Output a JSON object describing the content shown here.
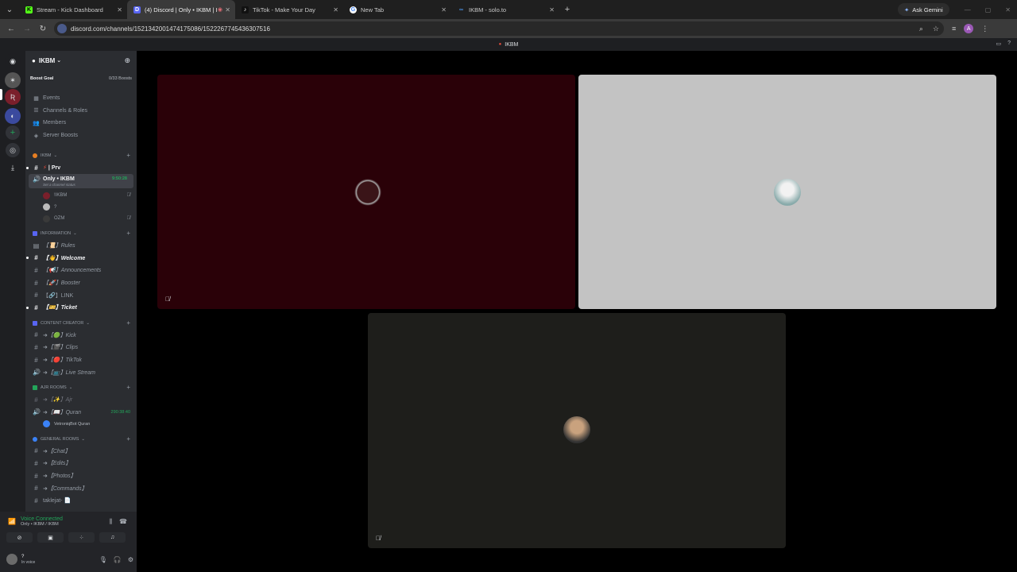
{
  "browser": {
    "tabs": [
      {
        "title": "Stream - Kick Dashboard",
        "favicon": "K",
        "color": "#53fc18",
        "active": false
      },
      {
        "title": "(4) Discord | Only • IKBM | I",
        "favicon": "D",
        "color": "#5865f2",
        "active": true
      },
      {
        "title": "TikTok - Make Your Day",
        "favicon": "♪",
        "color": "#000000",
        "active": false
      },
      {
        "title": "New Tab",
        "favicon": "G",
        "color": "#4285f4",
        "active": false
      },
      {
        "title": "IKBM - solo.to",
        "favicon": "∞",
        "color": "#4a90e2",
        "active": false
      }
    ],
    "gemini_label": "Ask Gemini",
    "url": "discord.com/channels/1521342001474175086/1522267745436307516",
    "profile_initial": "A"
  },
  "discord": {
    "window_title": "IKBM",
    "server_name": "IKBM",
    "boost_goal": {
      "label": "Boost Goal",
      "progress": "0/33 Boosts"
    },
    "menu": [
      {
        "label": "Events",
        "icon": "calendar-icon",
        "glyph": "▦"
      },
      {
        "label": "Channels & Roles",
        "icon": "channels-icon",
        "glyph": "☰"
      },
      {
        "label": "Members",
        "icon": "members-icon",
        "glyph": "👥"
      },
      {
        "label": "Server Boosts",
        "icon": "boost-icon",
        "glyph": "◈"
      }
    ],
    "cat_ikbm": "IKBM",
    "prv_channel": "| Prv",
    "voice_active": {
      "name": "Only • IKBM",
      "status": "Set a channel status",
      "timer": "9:50:28"
    },
    "voice_users": [
      {
        "name": "!IKBM",
        "color": "#7a1f2b",
        "muted": true
      },
      {
        "name": "?",
        "color": "#bbbbbb",
        "muted": false
      },
      {
        "name": "OZM",
        "color": "#3a3a3a",
        "muted": true
      }
    ],
    "cat_information": "INFORMATION",
    "info_channels": [
      {
        "label": "【📜】Rules",
        "icon": "rules-icon",
        "bold": false,
        "unread": false
      },
      {
        "label": "【👋】Welcome",
        "icon": "hash-icon",
        "bold": true,
        "unread": true
      },
      {
        "label": "【📢】Announcements",
        "icon": "hash-icon",
        "bold": false,
        "unread": false
      },
      {
        "label": "【🚀】Booster",
        "icon": "hash-icon",
        "bold": false,
        "unread": false
      },
      {
        "label": "【🔗】LINK",
        "icon": "hash-icon",
        "bold": false,
        "unread": false
      },
      {
        "label": "【🎫】Ticket",
        "icon": "hash-icon",
        "bold": true,
        "unread": true
      }
    ],
    "cat_content": "CONTENT CREATOR",
    "content_channels": [
      {
        "label": "➜【🟢】Kick",
        "icon": "hash-icon"
      },
      {
        "label": "➜【🎬】Clips",
        "icon": "hash-icon"
      },
      {
        "label": "➜【🔴】TikTok",
        "icon": "hash-icon"
      },
      {
        "label": "➜【📺】Live Stream",
        "icon": "speaker-icon"
      }
    ],
    "cat_ajr": "AJR ROOMS",
    "ajr_channels": [
      {
        "label": "➜【✨】Ajr",
        "icon": "hash-icon",
        "timer": ""
      },
      {
        "label": "➜【📖】Quran",
        "icon": "speaker-icon",
        "timer": "290:38:40"
      }
    ],
    "quran_user": "VetroniqBot Quran",
    "cat_general": "GENERAL ROOMS",
    "general_channels": [
      {
        "label": "➜【Chat】",
        "icon": "hash-icon"
      },
      {
        "label": "➜【Edits】",
        "icon": "hash-icon"
      },
      {
        "label": "➜【Photos】",
        "icon": "hash-icon"
      },
      {
        "label": "➜【Commands】",
        "icon": "hash-icon"
      },
      {
        "label": "taklejat- 📄",
        "icon": "hash-icon"
      }
    ],
    "voice_connected": {
      "title": "Voice Connected",
      "sub": "Only • IKBM / IKBM"
    },
    "user": {
      "name": "?",
      "status": "In voice"
    },
    "colors": {
      "accent_green": "#23a55a",
      "tile_red": "#2a0108",
      "tile_light": "#c3c3c3",
      "tile_dark": "#1e1e1b"
    }
  }
}
